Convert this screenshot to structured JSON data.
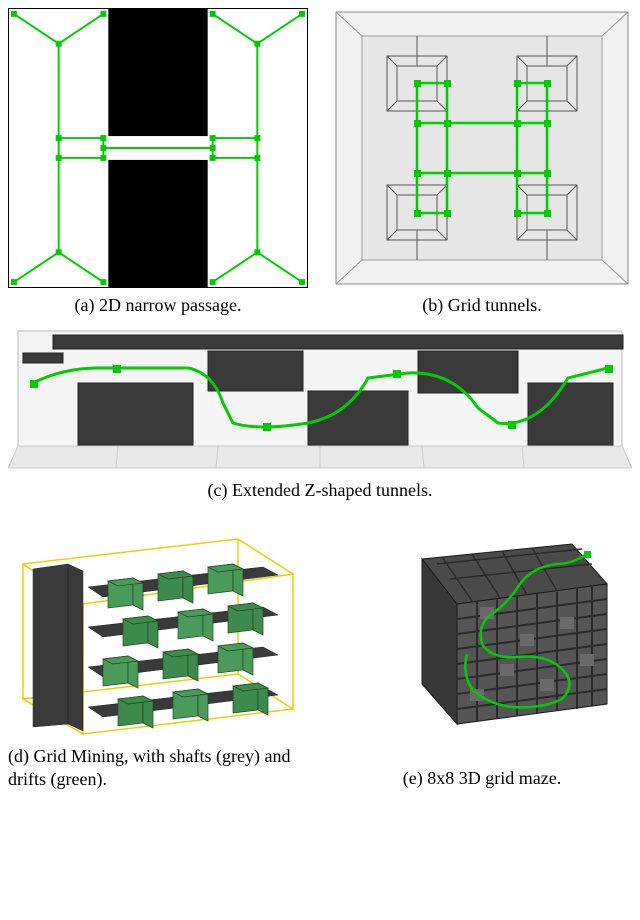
{
  "subfigs": {
    "a": {
      "caption": "(a) 2D narrow passage."
    },
    "b": {
      "caption": "(b) Grid tunnels."
    },
    "c": {
      "caption": "(c) Extended Z-shaped tunnels."
    },
    "d": {
      "caption": "(d) Grid Mining, with shafts (grey) and drifts (green)."
    },
    "e": {
      "caption": "(e) 8x8 3D grid maze."
    }
  }
}
